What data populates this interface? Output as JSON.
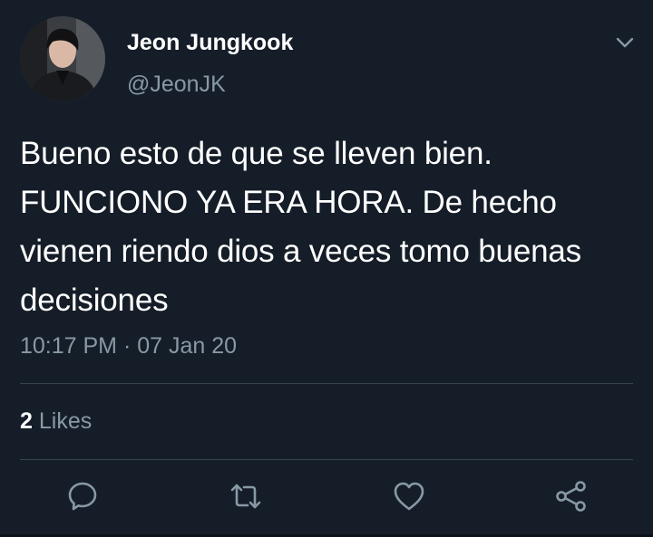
{
  "user": {
    "display_name": "Jeon Jungkook",
    "handle": "@JeonJK",
    "avatar": "profile-photo"
  },
  "tweet": {
    "text": "Bueno esto de que se lleven bien. FUNCIONO YA ERA HORA. De hecho vienen riendo dios a veces tomo buenas decisiones",
    "time": "10:17 PM",
    "separator": "·",
    "date": "07 Jan 20"
  },
  "stats": {
    "likes_count": "2",
    "likes_label": "Likes"
  },
  "actions": [
    {
      "icon": "reply-icon"
    },
    {
      "icon": "retweet-icon"
    },
    {
      "icon": "like-icon"
    },
    {
      "icon": "share-icon"
    }
  ],
  "colors": {
    "background": "#151d28",
    "primary_text": "#ffffff",
    "secondary_text": "#8899a6",
    "divider": "#38444d"
  }
}
